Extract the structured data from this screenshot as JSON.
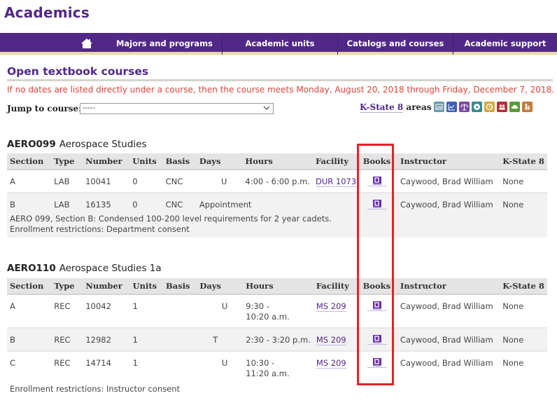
{
  "site": {
    "title": "Academics"
  },
  "nav": {
    "home_icon": "home-icon",
    "items": [
      "Majors and programs",
      "Academic units",
      "Catalogs and courses",
      "Academic support"
    ]
  },
  "page": {
    "title": "Open textbook courses",
    "notice": "If no dates are listed directly under a course, then the course meets Monday, August 20, 2018 through Friday, December 7, 2018.",
    "jump_label": "Jump to course:",
    "jump_value": "-----",
    "ks8_link": "K-State 8",
    "ks8_suffix": " areas",
    "ks8_icons": [
      {
        "name": "aesthetic-interpretation-icon",
        "color": "#6a9bb0"
      },
      {
        "name": "empirical-quantitative-icon",
        "color": "#3d5fb8"
      },
      {
        "name": "ethical-reasoning-icon",
        "color": "#7b4aa0"
      },
      {
        "name": "global-issues-icon",
        "color": "#3a8a8f"
      },
      {
        "name": "historical-perspectives-icon",
        "color": "#d4a93a"
      },
      {
        "name": "human-diversity-icon",
        "color": "#b0323a"
      },
      {
        "name": "natural-physical-sciences-icon",
        "color": "#5a9a3a"
      },
      {
        "name": "social-behavioral-sciences-icon",
        "color": "#c77a3a"
      }
    ]
  },
  "columns": [
    "Section",
    "Type",
    "Number",
    "Units",
    "Basis",
    "Days",
    "Hours",
    "Facility",
    "Books",
    "Instructor",
    "K-State 8"
  ],
  "courses": [
    {
      "code": "AERO099",
      "name": "Aerospace Studies",
      "rows": [
        {
          "section": "A",
          "type": "LAB",
          "number": "10041",
          "units": "0",
          "basis": "CNC",
          "days": "U",
          "hours": "4:00 - 6:00 p.m.",
          "facility": "DUR 1073",
          "instructor": "Caywood, Brad William",
          "ks8": "None"
        },
        {
          "section": "B",
          "type": "LAB",
          "number": "16135",
          "units": "0",
          "basis": "CNC",
          "days": "Appointment",
          "hours": "",
          "facility": "",
          "instructor": "Caywood, Brad William",
          "ks8": "None",
          "notes": [
            "AERO 099, Section B: Condensed 100-200 level requirements for 2 year cadets.",
            "Enrollment restrictions: Department consent"
          ]
        }
      ]
    },
    {
      "code": "AERO110",
      "name": "Aerospace Studies 1a",
      "rows": [
        {
          "section": "A",
          "type": "REC",
          "number": "10042",
          "units": "1",
          "basis": "",
          "days": "U",
          "hours_1": "9:30 -",
          "hours_2": "10:20 a.m.",
          "facility": "MS 209",
          "instructor": "Caywood, Brad William",
          "ks8": "None"
        },
        {
          "section": "B",
          "type": "REC",
          "number": "12982",
          "units": "1",
          "basis": "",
          "days": "T",
          "hours": "2:30 - 3:20 p.m.",
          "facility": "MS 209",
          "instructor": "Caywood, Brad William",
          "ks8": "None"
        },
        {
          "section": "C",
          "type": "REC",
          "number": "14714",
          "units": "1",
          "basis": "",
          "days": "U",
          "hours_1": "10:30 -",
          "hours_2": "11:20 a.m.",
          "facility": "MS 209",
          "instructor": "Caywood, Brad William",
          "ks8": "None"
        }
      ],
      "footnote": "Enrollment restrictions: Instructor consent"
    }
  ],
  "colors": {
    "brand_purple": "#512888",
    "gold_rule": "#ead7a0",
    "notice_red": "#d9453a",
    "highlight_red": "#e2232b"
  }
}
